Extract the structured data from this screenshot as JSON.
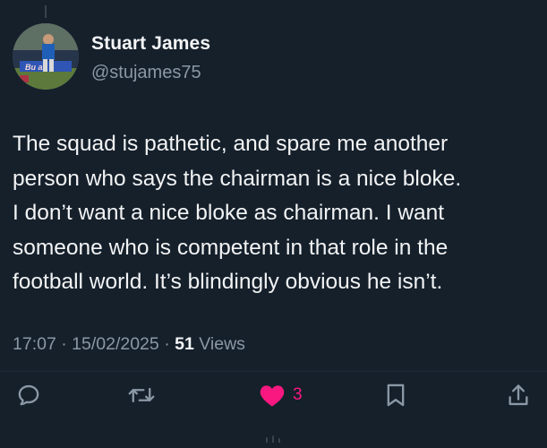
{
  "author": {
    "display_name": "Stuart James",
    "handle": "@stujames75",
    "avatar_icon": "profile-photo-footballer"
  },
  "tweet": {
    "text_lines": [
      "The squad is pathetic, and spare me another",
      "person who says the chairman is a nice bloke.",
      "I don’t want a nice bloke as chairman. I want",
      "someone who is competent in that role in the",
      "football world. It’s blindingly obvious he isn’t."
    ],
    "time": "17:07",
    "date": "15/02/2025",
    "separator": "·",
    "views_count": "51",
    "views_label": "Views"
  },
  "actions": {
    "reply_icon": "reply-bubble-icon",
    "retweet_icon": "retweet-arrows-icon",
    "like_icon": "heart-filled-icon",
    "like_count": "3",
    "bookmark_icon": "bookmark-icon",
    "share_icon": "share-upload-icon"
  },
  "colors": {
    "background": "#15202b",
    "text": "#e7e9ea",
    "secondary": "#8b98a5",
    "like": "#f91880"
  }
}
